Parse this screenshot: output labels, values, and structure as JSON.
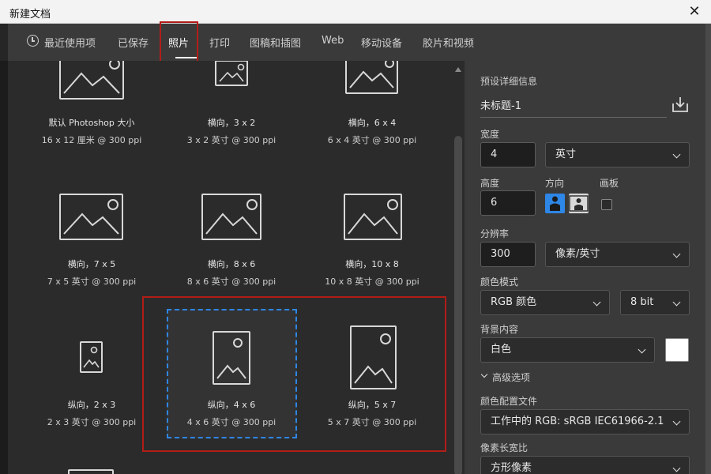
{
  "window": {
    "title": "新建文档"
  },
  "tabs": [
    {
      "label": "最近使用项",
      "icon": "clock-icon"
    },
    {
      "label": "已保存"
    },
    {
      "label": "照片"
    },
    {
      "label": "打印"
    },
    {
      "label": "图稿和插图"
    },
    {
      "label": "Web"
    },
    {
      "label": "移动设备"
    },
    {
      "label": "胶片和视频"
    }
  ],
  "active_tab": "照片",
  "presets": [
    {
      "name": "默认 Photoshop 大小",
      "dims": "16 x 12 厘米 @ 300 ppi"
    },
    {
      "name": "横向，3 x 2",
      "dims": "3 x 2 英寸 @ 300 ppi"
    },
    {
      "name": "横向，6 x 4",
      "dims": "6 x 4 英寸 @ 300 ppi"
    },
    {
      "name": "横向，7 x 5",
      "dims": "7 x 5 英寸 @ 300 ppi"
    },
    {
      "name": "横向，8 x 6",
      "dims": "8 x 6 英寸 @ 300 ppi"
    },
    {
      "name": "横向，10 x 8",
      "dims": "10 x 8 英寸 @ 300 ppi"
    },
    {
      "name": "纵向，2 x 3",
      "dims": "2 x 3 英寸 @ 300 ppi"
    },
    {
      "name": "纵向，4 x 6",
      "dims": "4 x 6 英寸 @ 300 ppi",
      "selected": true
    },
    {
      "name": "纵向，5 x 7",
      "dims": "5 x 7 英寸 @ 300 ppi"
    }
  ],
  "panel": {
    "section_title": "预设详细信息",
    "doc_name": "未标题-1",
    "width_label": "宽度",
    "width_value": "4",
    "width_unit": "英寸",
    "height_label": "高度",
    "height_value": "6",
    "orientation_label": "方向",
    "artboard_label": "画板",
    "resolution_label": "分辨率",
    "resolution_value": "300",
    "resolution_unit": "像素/英寸",
    "color_mode_label": "颜色模式",
    "color_mode_value": "RGB 颜色",
    "bit_depth_value": "8 bit",
    "background_label": "背景内容",
    "background_value": "白色",
    "background_color": "#ffffff",
    "advanced_label": "高级选项",
    "color_profile_label": "颜色配置文件",
    "color_profile_value": "工作中的 RGB: sRGB IEC61966-2.1",
    "pixel_aspect_label": "像素长宽比",
    "pixel_aspect_value": "方形像素"
  },
  "colors": {
    "highlight_red": "#b21d17",
    "selection_blue": "#2e86e6",
    "orientation_active": "#2e86e6"
  }
}
